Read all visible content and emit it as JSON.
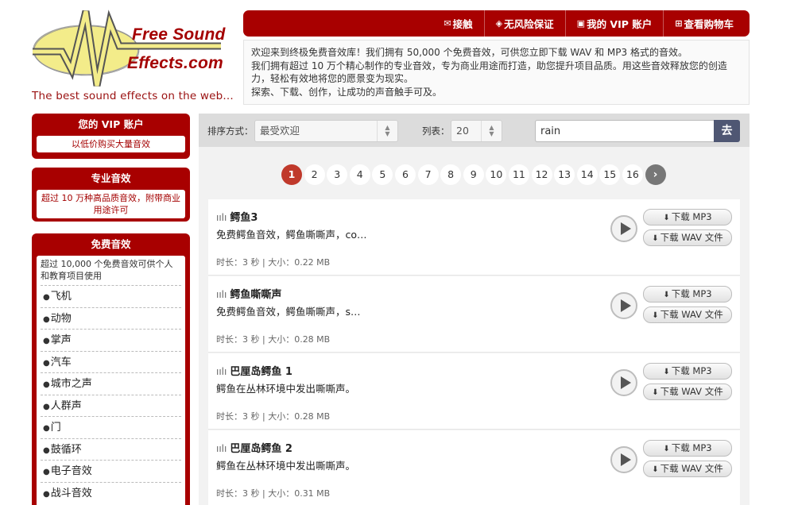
{
  "brand": {
    "logo_line1": "Free Sound",
    "logo_line2": "Effects.com",
    "tagline": "The best sound effects on the web..."
  },
  "nav": [
    {
      "label": "接触",
      "icon": "envelope-icon"
    },
    {
      "label": "无风险保证",
      "icon": "shield-icon"
    },
    {
      "label": "我的 VIP 账户",
      "icon": "user-icon"
    },
    {
      "label": "查看购物车",
      "icon": "cart-icon"
    }
  ],
  "intro": {
    "line1": "欢迎来到终极免费音效库！我们拥有 50,000 个免费音效，可供您立即下载 WAV 和 MP3 格式的音效。",
    "line2": "我们拥有超过 10 万个精心制作的专业音效，专为商业用途而打造，助您提升项目品质。用这些音效释放您的创造力，轻松有效地将您的愿景变为现实。",
    "line3": "探索、下载、创作，让成功的声音触手可及。"
  },
  "sidebar": {
    "vip": {
      "title": "您的 VIP 账户",
      "body": "以低价购买大量音效"
    },
    "pro": {
      "title": "专业音效",
      "body": "超过 10 万种高品质音效，附带商业用途许可"
    },
    "free": {
      "title": "免费音效",
      "body": "超过 10,000 个免费音效可供个人和教育项目使用",
      "categories": [
        "飞机",
        "动物",
        "掌声",
        "汽车",
        "城市之声",
        "人群声",
        "门",
        "鼓循环",
        "电子音效",
        "战斗音效"
      ]
    }
  },
  "toolbar": {
    "sort_label": "排序方式：",
    "sort_value": "最受欢迎",
    "list_label": "列表：",
    "list_value": "20",
    "search_value": "rain",
    "search_button": "去"
  },
  "pagination": {
    "current": 1,
    "pages": [
      "1",
      "2",
      "3",
      "4",
      "5",
      "6",
      "7",
      "8",
      "9",
      "10",
      "11",
      "12",
      "13",
      "14",
      "15",
      "16"
    ],
    "next": "›"
  },
  "results": [
    {
      "title": "鳄鱼3",
      "desc": "免费鳄鱼音效，鳄鱼嘶嘶声，co…",
      "meta": "时长：3 秒 | 大小：0.22 MB",
      "mp3": "下载 MP3",
      "wav": "下载 WAV 文件"
    },
    {
      "title": "鳄鱼嘶嘶声",
      "desc": "免费鳄鱼音效，鳄鱼嘶嘶声，s…",
      "meta": "时长：3 秒 | 大小：0.28 MB",
      "mp3": "下载 MP3",
      "wav": "下载 WAV 文件"
    },
    {
      "title": "巴厘岛鳄鱼 1",
      "desc": "鳄鱼在丛林环境中发出嘶嘶声。",
      "meta": "时长：3 秒 | 大小：0.28 MB",
      "mp3": "下载 MP3",
      "wav": "下载 WAV 文件"
    },
    {
      "title": "巴厘岛鳄鱼 2",
      "desc": "鳄鱼在丛林环境中发出嘶嘶声。",
      "meta": "时长：3 秒 | 大小：0.31 MB",
      "mp3": "下载 MP3",
      "wav": "下载 WAV 文件"
    }
  ],
  "colors": {
    "brand_red": "#a80000",
    "logo_yellow": "#f3ec8a",
    "search_button": "#4f5773",
    "active_page": "#c0392b"
  }
}
